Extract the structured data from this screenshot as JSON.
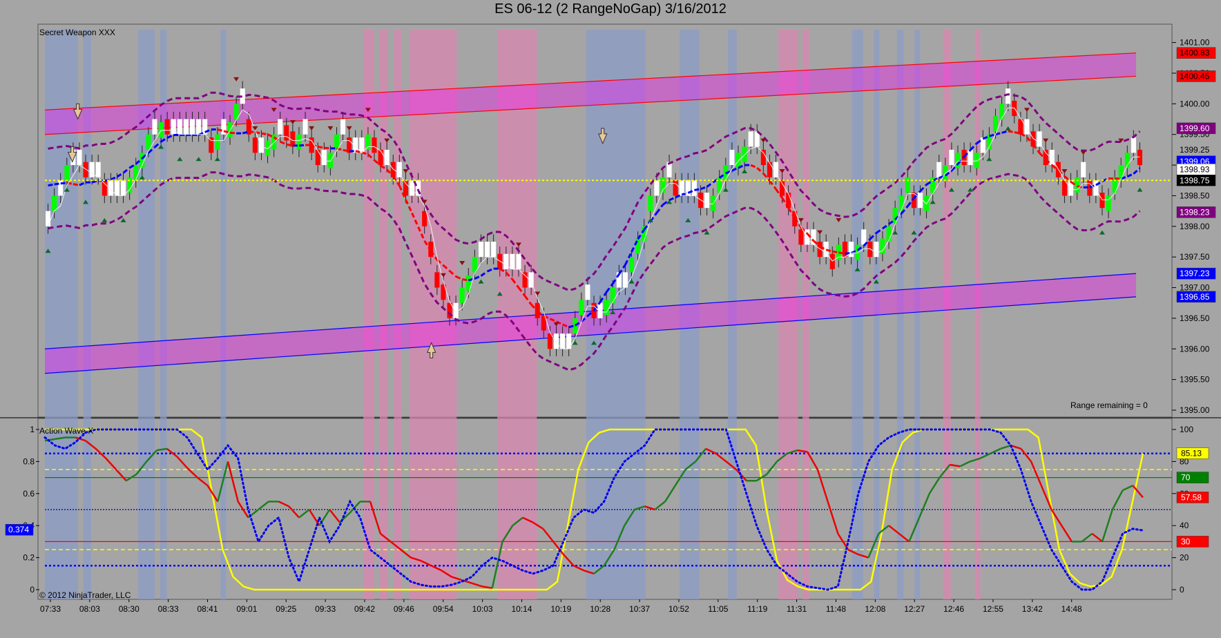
{
  "window": {
    "title": "ES 06-12 (2 RangeNoGap)  3/16/2012"
  },
  "colors": {
    "background": "#a5a5a5",
    "up_bar": "#00ff00",
    "down_bar": "#ff0000",
    "neutral_bar": "#ffffff",
    "upper_band": "#ff00ff",
    "upper_line": "#ff0000",
    "lower_line": "#0000ff",
    "ma_up": "#0000ff",
    "ma_down": "#ff0000",
    "envelope": "#800080",
    "yellow_line": "#ffff00",
    "shade_blue": "#8c9cc6",
    "shade_pink": "#d888b0"
  },
  "chart_data": [
    {
      "type": "candlestick",
      "indicator_label": "Secret Weapon XXX",
      "footer_text": "Range remaining = 0",
      "y_ticks": [
        1401.0,
        1400.5,
        1400.0,
        1399.5,
        1399.0,
        1398.5,
        1398.0,
        1397.5,
        1397.0,
        1396.5,
        1396.0,
        1395.5,
        1395.0
      ],
      "ylim": [
        1395.0,
        1401.3
      ],
      "price_badges": [
        {
          "value": "1400.83",
          "price": 1400.83,
          "bg": "#ff0000",
          "fg": "#000000"
        },
        {
          "value": "1400.45",
          "price": 1400.45,
          "bg": "#ff0000",
          "fg": "#000000"
        },
        {
          "value": "1399.60",
          "price": 1399.6,
          "bg": "#800080",
          "fg": "#ffffff"
        },
        {
          "value": "1399.25",
          "price": 1399.25,
          "bg": "none",
          "fg": "#000000"
        },
        {
          "value": "1399.06",
          "price": 1399.06,
          "bg": "#0000ff",
          "fg": "#ffffff"
        },
        {
          "value": "1398.93",
          "price": 1398.93,
          "bg": "#ffffff",
          "fg": "#000000"
        },
        {
          "value": "1398.75",
          "price": 1398.75,
          "bg": "#000000",
          "fg": "#ffffff"
        },
        {
          "value": "1398.23",
          "price": 1398.23,
          "bg": "#800080",
          "fg": "#ffffff"
        },
        {
          "value": "1397.23",
          "price": 1397.23,
          "bg": "#0000ff",
          "fg": "#ffffff"
        },
        {
          "value": "1396.85",
          "price": 1396.85,
          "bg": "#0000ff",
          "fg": "#ffffff"
        }
      ],
      "reference_price": 1398.75,
      "upper_channel": {
        "start": [
          1399.9,
          1399.5
        ],
        "end": [
          1400.83,
          1400.45
        ]
      },
      "lower_channel": {
        "start": [
          1396.0,
          1395.6
        ],
        "end": [
          1397.23,
          1396.85
        ]
      },
      "series": [
        {
          "kind": "bars",
          "closes": [
            1398.0,
            1398.5,
            1398.5,
            1399.0,
            1399.0,
            1399.0,
            1398.8,
            1398.8,
            1398.8,
            1398.5,
            1398.5,
            1398.5,
            1398.5,
            1398.8,
            1399.0,
            1399.2,
            1399.5,
            1399.5,
            1399.7,
            1399.5,
            1399.5,
            1399.5,
            1399.5,
            1399.5,
            1399.5,
            1399.5,
            1399.2,
            1399.5,
            1399.5,
            1399.7,
            1400.0,
            1400.0,
            1399.5,
            1399.2,
            1399.2,
            1399.4,
            1399.5,
            1399.5,
            1399.4,
            1399.3,
            1399.5,
            1399.5,
            1399.2,
            1399.0,
            1399.0,
            1399.2,
            1399.5,
            1399.5,
            1399.2,
            1399.2,
            1399.2,
            1399.5,
            1399.2,
            1399.0,
            1399.0,
            1398.8,
            1398.8,
            1398.5,
            1398.5,
            1398.5,
            1398.0,
            1397.5,
            1397.0,
            1396.8,
            1396.5,
            1396.5,
            1397.0,
            1397.2,
            1397.5,
            1397.5,
            1397.5,
            1397.5,
            1397.3,
            1397.3,
            1397.3,
            1397.3,
            1397.0,
            1397.0,
            1396.5,
            1396.3,
            1396.0,
            1396.0,
            1396.0,
            1396.0,
            1396.5,
            1396.8,
            1396.8,
            1396.5,
            1396.5,
            1396.8,
            1397.0,
            1397.0,
            1397.0,
            1397.5,
            1397.8,
            1398.0,
            1398.5,
            1398.5,
            1398.8,
            1398.8,
            1398.5,
            1398.5,
            1398.5,
            1398.5,
            1398.3,
            1398.3,
            1398.5,
            1398.8,
            1399.0,
            1399.0,
            1399.2,
            1399.3,
            1399.3,
            1399.3,
            1399.0,
            1398.8,
            1398.8,
            1398.5,
            1398.3,
            1398.0,
            1397.7,
            1397.7,
            1397.7,
            1397.5,
            1397.5,
            1397.3,
            1397.7,
            1397.5,
            1397.5,
            1397.7,
            1397.7,
            1397.5,
            1397.5,
            1397.8,
            1398.0,
            1398.3,
            1398.5,
            1398.8,
            1398.3,
            1398.3,
            1398.5,
            1398.8,
            1398.8,
            1399.0,
            1399.0,
            1399.2,
            1399.0,
            1399.0,
            1399.2,
            1399.2,
            1399.5,
            1399.8,
            1400.0,
            1400.0,
            1399.8,
            1399.5,
            1399.5,
            1399.3,
            1399.3,
            1399.0,
            1399.0,
            1398.8,
            1398.5,
            1398.5,
            1398.8,
            1398.8,
            1398.5,
            1398.5,
            1398.3,
            1398.5,
            1398.8,
            1399.0,
            1399.2,
            1399.2,
            1399.0
          ]
        },
        {
          "kind": "line",
          "name": "moving-average"
        },
        {
          "kind": "line",
          "name": "envelope-upper"
        },
        {
          "kind": "line",
          "name": "envelope-lower"
        }
      ]
    },
    {
      "type": "line",
      "indicator_label": "Action Wave X",
      "copyright": "© 2012 NinjaTrader, LLC",
      "left_ticks": [
        "1",
        "0.8",
        "0.6",
        "0.4",
        "0.2",
        "0"
      ],
      "right_ticks": [
        "100",
        "80",
        "60",
        "40",
        "20",
        "0"
      ],
      "ylim": [
        0,
        100
      ],
      "left_badge": "0.374",
      "right_badges": [
        {
          "value": "85.13",
          "level": 85.13,
          "bg": "#ffff00",
          "fg": "#000000"
        },
        {
          "value": "70",
          "level": 70,
          "bg": "#008000",
          "fg": "#ffffff"
        },
        {
          "value": "57.58",
          "level": 57.58,
          "bg": "#ff0000",
          "fg": "#ffffff"
        },
        {
          "value": "30",
          "level": 30,
          "bg": "#ff0000",
          "fg": "#ffffff"
        }
      ],
      "h_levels": [
        {
          "level": 85,
          "color": "#0000ff",
          "dash": "3,3",
          "width": 2.5
        },
        {
          "level": 75,
          "color": "#ffff00",
          "dash": "6,4",
          "width": 1.5
        },
        {
          "level": 70,
          "color": "#008000",
          "dash": "",
          "width": 1.2
        },
        {
          "level": 50,
          "color": "#000080",
          "dash": "2,2",
          "width": 1.2
        },
        {
          "level": 30,
          "color": "#ff0000",
          "dash": "",
          "width": 1.2
        },
        {
          "level": 25,
          "color": "#ffff00",
          "dash": "6,4",
          "width": 1.5
        },
        {
          "level": 15,
          "color": "#0000ff",
          "dash": "3,3",
          "width": 2.5
        }
      ],
      "series": [
        {
          "kind": "line",
          "name": "yellow",
          "values": [
            100,
            100,
            100,
            100,
            100,
            100,
            100,
            100,
            100,
            100,
            100,
            100,
            100,
            100,
            100,
            95,
            60,
            25,
            8,
            2,
            0,
            0,
            0,
            0,
            0,
            0,
            0,
            0,
            0,
            0,
            0,
            0,
            0,
            0,
            0,
            0,
            0,
            0,
            0,
            0,
            0,
            0,
            0,
            0,
            0,
            0,
            0,
            0,
            0,
            5,
            40,
            75,
            92,
            98,
            100,
            100,
            100,
            100,
            100,
            100,
            100,
            100,
            100,
            100,
            100,
            100,
            100,
            100,
            90,
            50,
            18,
            6,
            2,
            0,
            0,
            0,
            0,
            0,
            0,
            5,
            35,
            75,
            92,
            98,
            100,
            100,
            100,
            100,
            100,
            100,
            100,
            100,
            100,
            100,
            100,
            95,
            60,
            25,
            10,
            4,
            2,
            3,
            8,
            25,
            55,
            85
          ]
        },
        {
          "kind": "line",
          "name": "green-red",
          "values": [
            93,
            94,
            95,
            95,
            93,
            88,
            82,
            75,
            68,
            72,
            80,
            87,
            88,
            83,
            76,
            70,
            65,
            55,
            80,
            55,
            45,
            50,
            55,
            55,
            52,
            45,
            50,
            40,
            50,
            42,
            48,
            55,
            55,
            35,
            30,
            25,
            20,
            18,
            15,
            12,
            8,
            6,
            4,
            2,
            1,
            30,
            40,
            45,
            42,
            38,
            30,
            22,
            15,
            12,
            10,
            15,
            25,
            40,
            50,
            52,
            50,
            55,
            65,
            75,
            80,
            88,
            85,
            80,
            75,
            68,
            68,
            72,
            80,
            85,
            87,
            86,
            75,
            55,
            35,
            25,
            22,
            20,
            35,
            40,
            35,
            30,
            45,
            60,
            70,
            78,
            77,
            80,
            82,
            85,
            88,
            90,
            88,
            80,
            65,
            50,
            40,
            30,
            30,
            35,
            30,
            50,
            62,
            65,
            57.58
          ]
        },
        {
          "kind": "line",
          "name": "blue-dotted",
          "values": [
            95,
            90,
            88,
            92,
            98,
            100,
            100,
            100,
            100,
            100,
            100,
            100,
            100,
            100,
            95,
            85,
            75,
            82,
            90,
            82,
            50,
            30,
            40,
            45,
            20,
            5,
            25,
            45,
            30,
            40,
            55,
            45,
            25,
            20,
            15,
            10,
            5,
            3,
            2,
            2,
            3,
            5,
            8,
            15,
            20,
            18,
            15,
            12,
            10,
            12,
            15,
            30,
            45,
            50,
            48,
            55,
            70,
            80,
            85,
            90,
            100,
            100,
            100,
            100,
            100,
            100,
            100,
            100,
            80,
            60,
            40,
            25,
            15,
            10,
            5,
            2,
            1,
            0,
            2,
            30,
            60,
            80,
            90,
            95,
            98,
            100,
            100,
            100,
            100,
            100,
            100,
            100,
            100,
            100,
            98,
            90,
            75,
            55,
            40,
            25,
            15,
            5,
            0,
            0,
            5,
            20,
            35,
            38,
            37
          ]
        }
      ]
    }
  ],
  "x_axis": {
    "labels": [
      "07:33",
      "08:03",
      "08:30",
      "08:33",
      "08:41",
      "09:01",
      "09:25",
      "09:33",
      "09:42",
      "09:46",
      "09:54",
      "10:03",
      "10:14",
      "10:19",
      "10:28",
      "10:37",
      "10:52",
      "11:05",
      "11:19",
      "11:31",
      "11:48",
      "12:08",
      "12:27",
      "12:46",
      "12:55",
      "13:42",
      "14:48"
    ]
  }
}
